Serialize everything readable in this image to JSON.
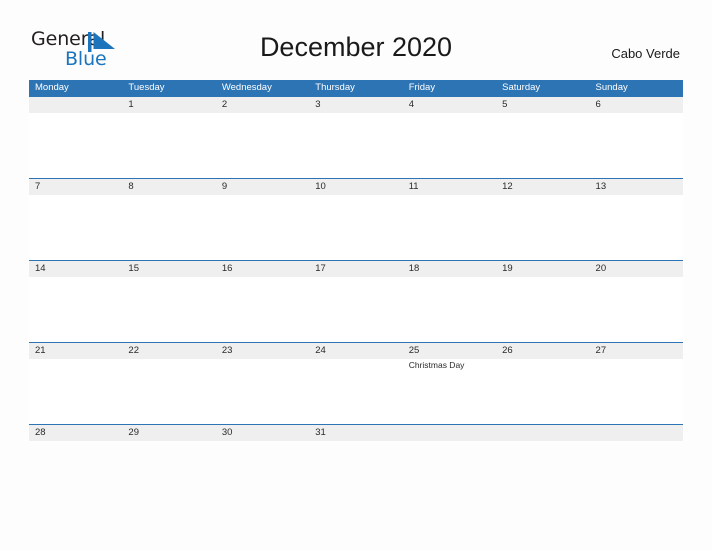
{
  "brand": {
    "word1": "General",
    "word2": "Blue",
    "mark": "triangle-flag-icon",
    "color_dark": "#231f20",
    "color_blue": "#1c75bc"
  },
  "header": {
    "title": "December 2020",
    "region": "Cabo Verde"
  },
  "theme": {
    "header_blue": "#2d74b5",
    "strip_gray": "#efefef",
    "page_background": "#fdfdfd",
    "text": "#2a2a2a"
  },
  "calendar": {
    "day_headers": [
      "Monday",
      "Tuesday",
      "Wednesday",
      "Thursday",
      "Friday",
      "Saturday",
      "Sunday"
    ],
    "weeks": [
      {
        "days": [
          {
            "date": "",
            "event": ""
          },
          {
            "date": "1",
            "event": ""
          },
          {
            "date": "2",
            "event": ""
          },
          {
            "date": "3",
            "event": ""
          },
          {
            "date": "4",
            "event": ""
          },
          {
            "date": "5",
            "event": ""
          },
          {
            "date": "6",
            "event": ""
          }
        ]
      },
      {
        "days": [
          {
            "date": "7",
            "event": ""
          },
          {
            "date": "8",
            "event": ""
          },
          {
            "date": "9",
            "event": ""
          },
          {
            "date": "10",
            "event": ""
          },
          {
            "date": "11",
            "event": ""
          },
          {
            "date": "12",
            "event": ""
          },
          {
            "date": "13",
            "event": ""
          }
        ]
      },
      {
        "days": [
          {
            "date": "14",
            "event": ""
          },
          {
            "date": "15",
            "event": ""
          },
          {
            "date": "16",
            "event": ""
          },
          {
            "date": "17",
            "event": ""
          },
          {
            "date": "18",
            "event": ""
          },
          {
            "date": "19",
            "event": ""
          },
          {
            "date": "20",
            "event": ""
          }
        ]
      },
      {
        "days": [
          {
            "date": "21",
            "event": ""
          },
          {
            "date": "22",
            "event": ""
          },
          {
            "date": "23",
            "event": ""
          },
          {
            "date": "24",
            "event": ""
          },
          {
            "date": "25",
            "event": "Christmas Day"
          },
          {
            "date": "26",
            "event": ""
          },
          {
            "date": "27",
            "event": ""
          }
        ]
      },
      {
        "days": [
          {
            "date": "28",
            "event": ""
          },
          {
            "date": "29",
            "event": ""
          },
          {
            "date": "30",
            "event": ""
          },
          {
            "date": "31",
            "event": ""
          },
          {
            "date": "",
            "event": ""
          },
          {
            "date": "",
            "event": ""
          },
          {
            "date": "",
            "event": ""
          }
        ]
      }
    ]
  }
}
